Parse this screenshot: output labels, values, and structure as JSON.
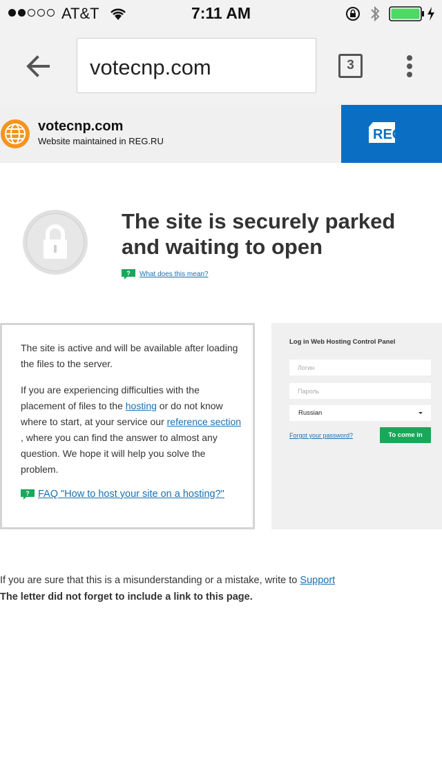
{
  "status_bar": {
    "signal_filled": 2,
    "signal_total": 5,
    "carrier": "AT&T",
    "time": "7:11 AM",
    "icons": [
      "wifi-icon",
      "rotation-lock-icon",
      "bluetooth-icon",
      "battery-icon",
      "charging-icon"
    ],
    "battery_level": 1.0
  },
  "browser": {
    "url": "votecnp.com",
    "tab_count": "3",
    "icons": [
      "back-arrow-icon",
      "overflow-menu-icon"
    ]
  },
  "banner": {
    "site_name": "votecnp.com",
    "maintained": "Website maintained in REG.RU",
    "logo_text": "REG.RU",
    "logo_color": "#0a6fc2"
  },
  "parked": {
    "headline": "The site is securely parked and waiting to open",
    "help_link": "What does this mean?"
  },
  "info": {
    "p1": "The site is active and will be available after loading the files to the server.",
    "p2_before": "If you are experiencing difficulties with the placement of files to the ",
    "hosting_link": "hosting",
    "p2_middle": " or do not know where to start, at your service our ",
    "reference_link": "reference section",
    "p2_after": " , where you can find the answer to almost any question. We hope it will help you solve the problem.",
    "faq": "FAQ \"How to host your site on a hosting?\""
  },
  "login": {
    "title": "Log in Web Hosting Control Panel",
    "login_placeholder": "Логин",
    "password_placeholder": "Пароль",
    "language": "Russian",
    "forgot": "Forgot your password?",
    "submit": "To come in",
    "submit_color": "#17a85a"
  },
  "footer": {
    "line1": "If you are sure that this is a misunderstanding or a mistake, write to ",
    "support_link": "Support ",
    "line2": "The letter did not forget to include a link to this page."
  }
}
